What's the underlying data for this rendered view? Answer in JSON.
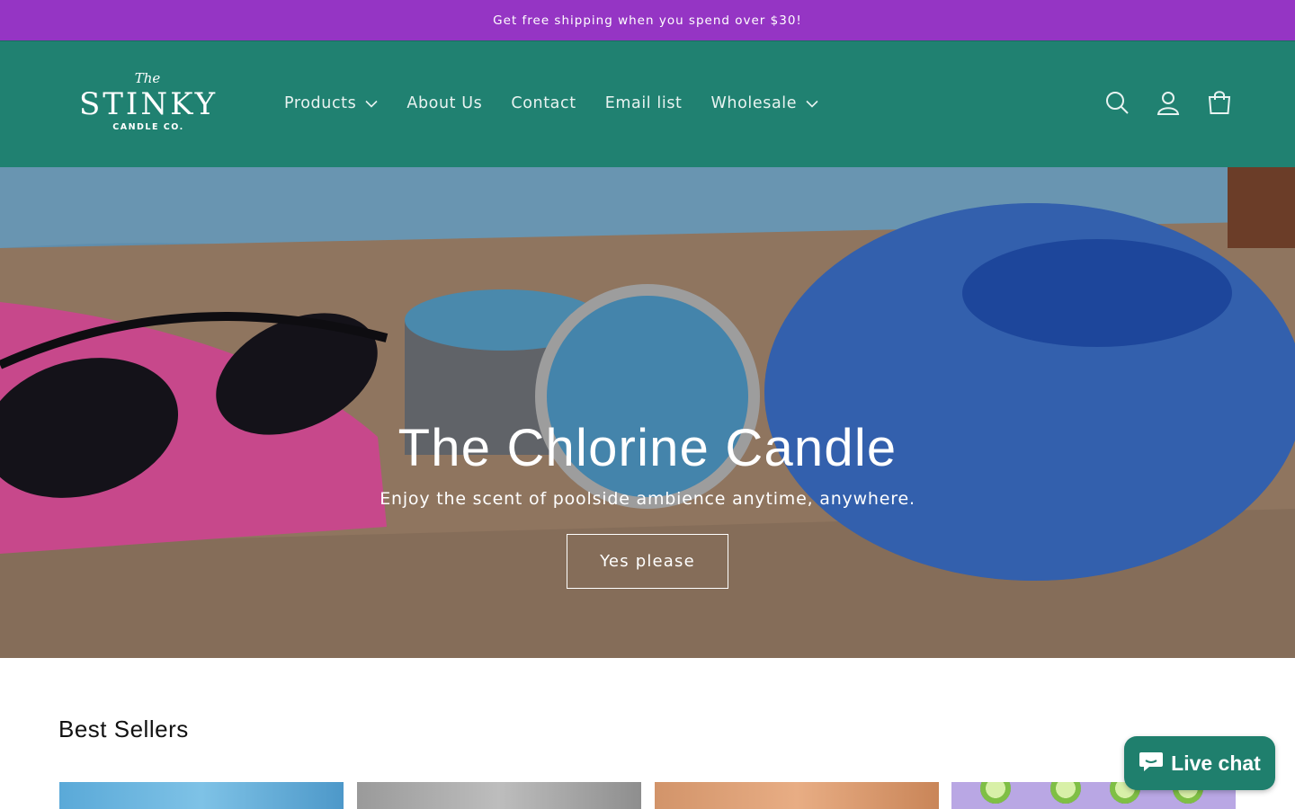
{
  "announcement": {
    "text": "Get free shipping when you spend over $30!"
  },
  "brand": {
    "logo_the": "The",
    "logo_main": "STINKY",
    "logo_sub": "CANDLE CO.",
    "colors": {
      "announcement_bg": "#9535c4",
      "header_bg": "#208171",
      "chat_bg": "#1f7f6d"
    }
  },
  "nav": {
    "items": [
      {
        "label": "Products",
        "has_dropdown": true
      },
      {
        "label": "About Us",
        "has_dropdown": false
      },
      {
        "label": "Contact",
        "has_dropdown": false
      },
      {
        "label": "Email list",
        "has_dropdown": false
      },
      {
        "label": "Wholesale",
        "has_dropdown": true
      }
    ]
  },
  "header_icons": [
    "search-icon",
    "account-icon",
    "cart-icon"
  ],
  "hero": {
    "title": "The Chlorine Candle",
    "subtitle": "Enjoy the scent of poolside ambience anytime, anywhere.",
    "button_label": "Yes please"
  },
  "best_sellers": {
    "title": "Best Sellers"
  },
  "live_chat": {
    "label": "Live chat"
  }
}
